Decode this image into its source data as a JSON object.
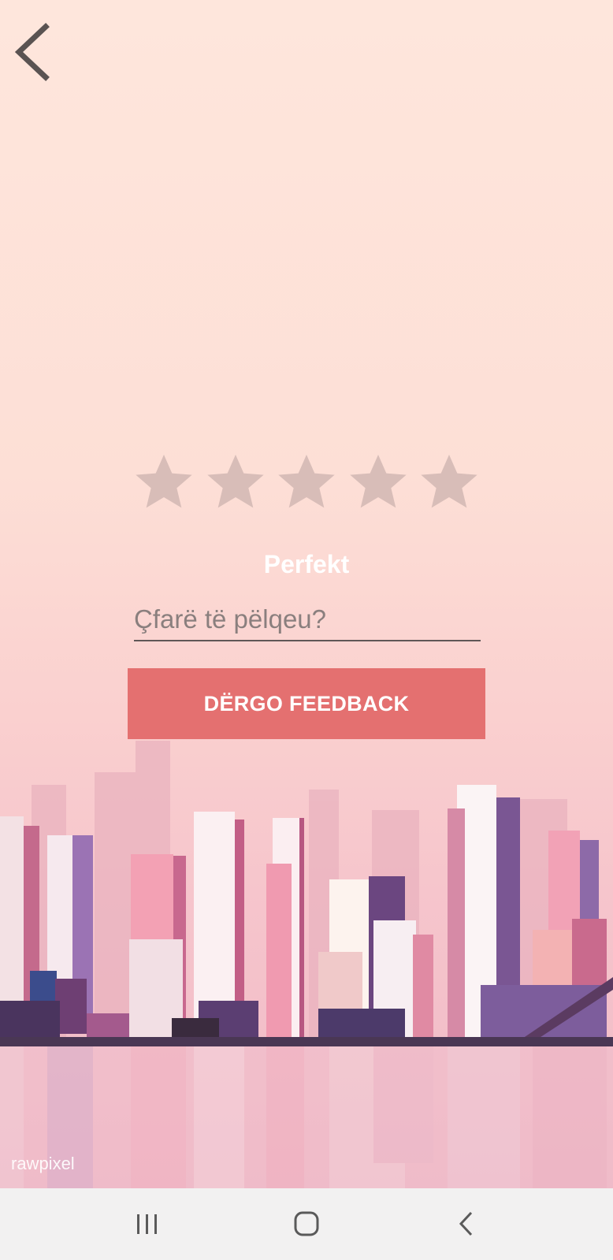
{
  "header": {
    "back_icon": "chevron-left-icon"
  },
  "rating": {
    "stars_total": 5,
    "selected_stars": 0,
    "star_icon": "star-icon",
    "star_color": "#d8bdb8",
    "label": "Perfekt"
  },
  "feedback": {
    "placeholder": "Çfarë të pëlqeu?",
    "value": ""
  },
  "submit": {
    "label": "DËRGO FEEDBACK",
    "color": "#e47070"
  },
  "background": {
    "watermark": "rawpixel"
  },
  "navbar": {
    "recents_icon": "recent-apps-icon",
    "home_icon": "home-icon",
    "back_icon": "back-icon"
  }
}
